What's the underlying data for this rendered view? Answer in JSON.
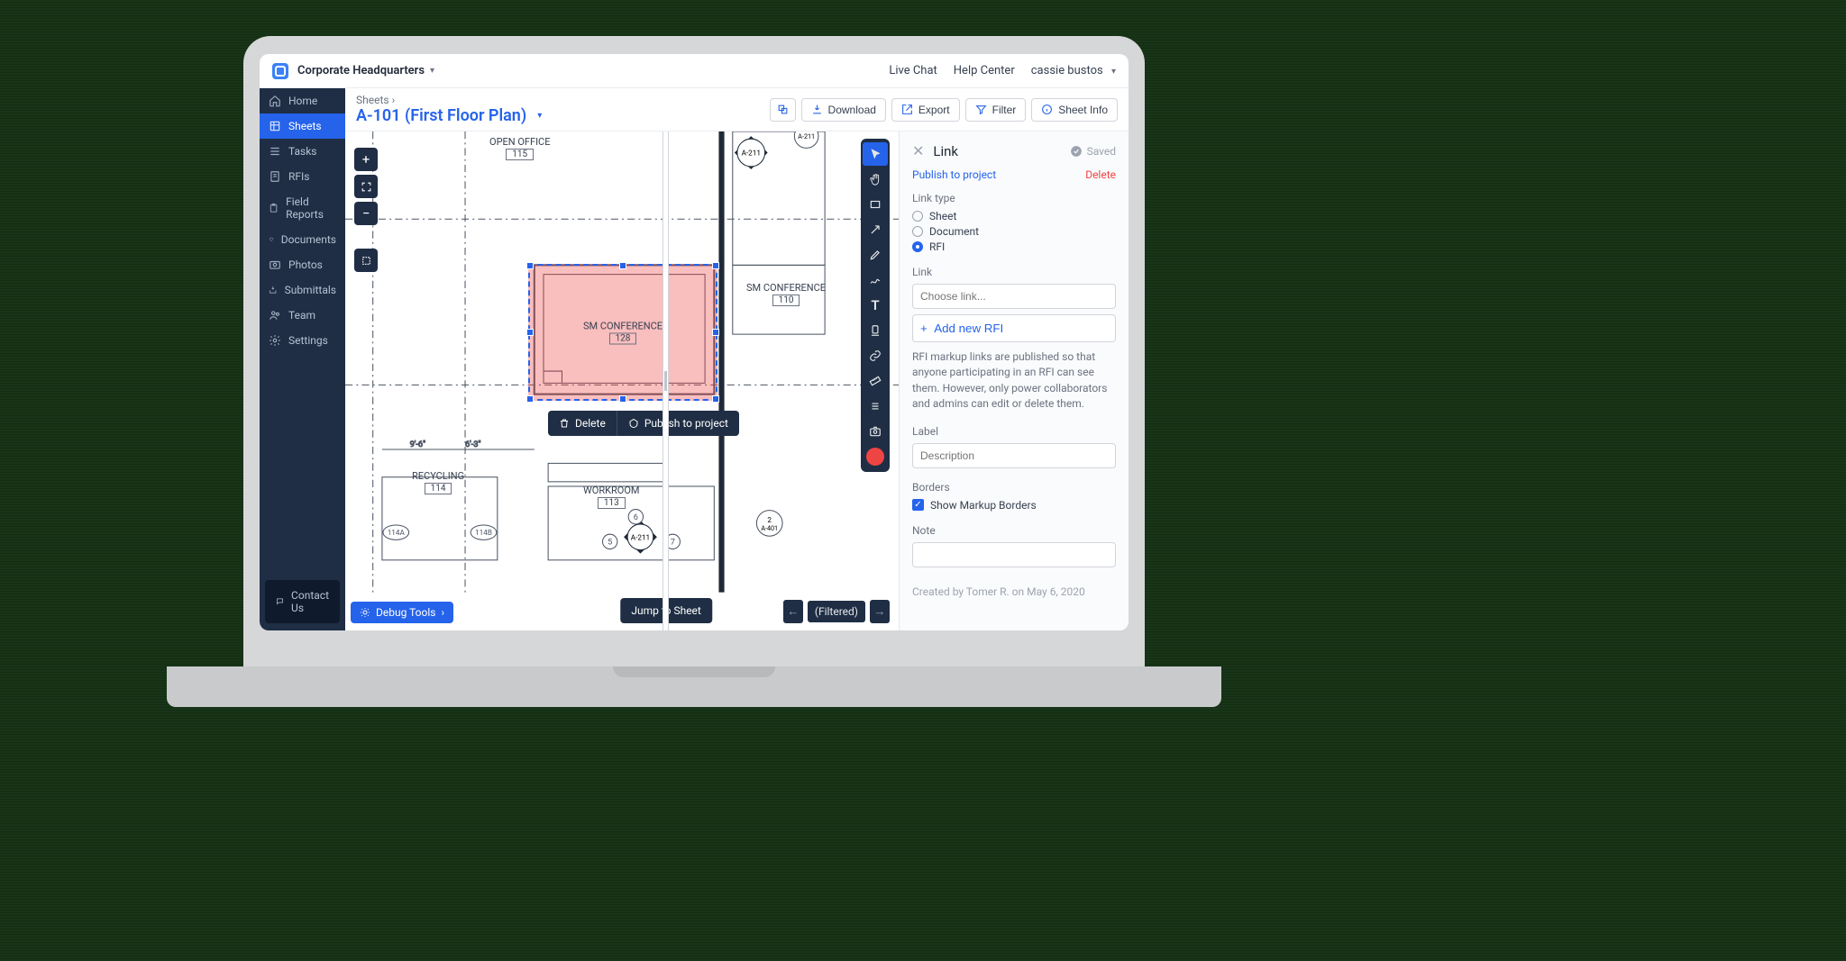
{
  "topbar": {
    "project": "Corporate Headquarters",
    "live_chat": "Live Chat",
    "help_center": "Help Center",
    "user": "cassie bustos"
  },
  "sidebar": {
    "items": [
      {
        "id": "home",
        "label": "Home"
      },
      {
        "id": "sheets",
        "label": "Sheets"
      },
      {
        "id": "tasks",
        "label": "Tasks"
      },
      {
        "id": "rfis",
        "label": "RFIs"
      },
      {
        "id": "field_reports",
        "label": "Field Reports"
      },
      {
        "id": "documents",
        "label": "Documents"
      },
      {
        "id": "photos",
        "label": "Photos"
      },
      {
        "id": "submittals",
        "label": "Submittals"
      },
      {
        "id": "team",
        "label": "Team"
      },
      {
        "id": "settings",
        "label": "Settings"
      }
    ],
    "active": "sheets",
    "contact": "Contact Us"
  },
  "header": {
    "crumb": "Sheets",
    "title": "A-101 (First Floor Plan)",
    "download": "Download",
    "export": "Export",
    "filter": "Filter",
    "sheet_info": "Sheet Info"
  },
  "plan": {
    "rooms": {
      "open_office": {
        "name": "OPEN OFFICE",
        "num": "115"
      },
      "sm_conf_128": {
        "name": "SM CONFERENCE",
        "num": "128"
      },
      "sm_conf_110": {
        "name": "SM CONFERENCE",
        "num": "110"
      },
      "recycling": {
        "name": "RECYCLING",
        "num": "114"
      },
      "workroom": {
        "name": "WORKROOM",
        "num": "113"
      }
    },
    "callouts": {
      "a211_top": "A-211",
      "a211_small": "A-211",
      "a211_bot": "A-211",
      "a401": {
        "num": "2",
        "sheet": "A-401"
      }
    },
    "doors": {
      "d114a": "114A",
      "d114b": "114B"
    },
    "dims": {
      "d96": "9'-6\"",
      "d63": "6'-3\""
    },
    "grid_nums": {
      "n5": "5",
      "n6": "6",
      "n7": "7"
    }
  },
  "context": {
    "delete": "Delete",
    "publish": "Publish to project"
  },
  "bottom": {
    "debug": "Debug Tools",
    "jump": "Jump to Sheet",
    "filtered": "(Filtered)"
  },
  "panel": {
    "title": "Link",
    "saved": "Saved",
    "publish": "Publish to project",
    "delete": "Delete",
    "link_type_label": "Link type",
    "types": {
      "sheet": "Sheet",
      "document": "Document",
      "rfi": "RFI"
    },
    "selected_type": "rfi",
    "link_label": "Link",
    "link_placeholder": "Choose link...",
    "add_new": "Add new RFI",
    "help": "RFI markup links are published so that anyone participating in an RFI can see them. However, only power collaborators and admins can edit or delete them.",
    "label_label": "Label",
    "label_placeholder": "Description",
    "borders_label": "Borders",
    "borders_check": "Show Markup Borders",
    "borders_checked": true,
    "note_label": "Note",
    "created": "Created by Tomer R. on May 6, 2020"
  }
}
